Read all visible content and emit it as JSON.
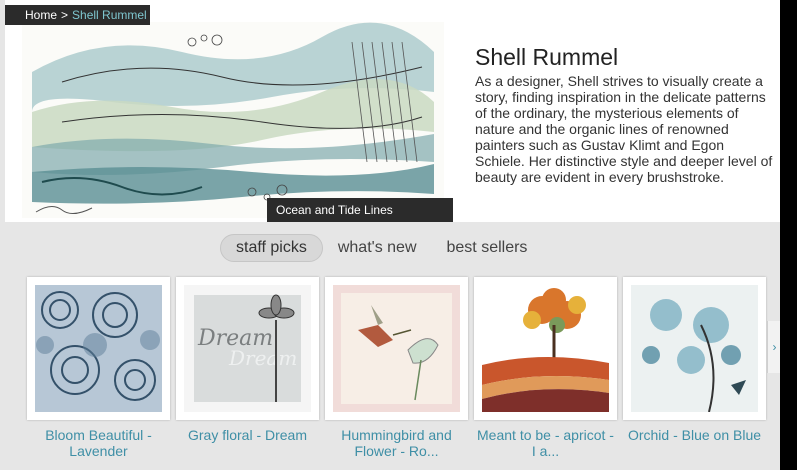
{
  "breadcrumb": {
    "home": "Home",
    "separator": ">",
    "current": "Shell Rummel"
  },
  "hero": {
    "artwork_caption": "Ocean and Tide Lines",
    "artist_name": "Shell Rummel",
    "bio": "As a designer, Shell strives to visually create a story, finding inspiration in the delicate patterns of the ordinary, the mysterious elements of nature and the organic lines of renowned painters such as Gustav Klimt and Egon Schiele. Her distinctive style and deeper level of beauty are evident in every brushstroke."
  },
  "tabs": [
    {
      "label": "staff picks",
      "active": true
    },
    {
      "label": "what's new",
      "active": false
    },
    {
      "label": "best sellers",
      "active": false
    }
  ],
  "products": [
    {
      "label": "Bloom Beautiful - Lavender",
      "icon": "blue-roses-artwork"
    },
    {
      "label": "Gray floral - Dream",
      "icon": "gray-flower-dream-artwork"
    },
    {
      "label": "Hummingbird and Flower - Ro...",
      "icon": "hummingbird-artwork"
    },
    {
      "label": "Meant to be - apricot - I a...",
      "icon": "autumn-tree-artwork"
    },
    {
      "label": "Orchid - Blue on Blue",
      "icon": "blue-orchid-artwork"
    }
  ],
  "carousel": {
    "next_glyph": "›"
  },
  "colors": {
    "link": "#3f8fa6",
    "dark_overlay": "#2b2b2b",
    "panel_bg": "#e6e6e6"
  }
}
